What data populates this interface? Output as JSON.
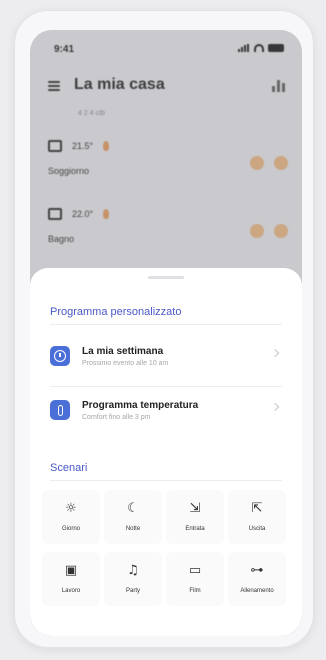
{
  "status": {
    "time": "9:41"
  },
  "header": {
    "title": "La mia casa",
    "subtitle": "4 2 4 ctb",
    "subtitle_display": " "
  },
  "rooms": [
    {
      "name": "Soggiorno",
      "temperature": "21.5°"
    },
    {
      "name": "Bagno",
      "temperature": "22.0°"
    }
  ],
  "sheet": {
    "program_section_title": "Programma personalizzato",
    "programs": [
      {
        "title": "La mia settimana",
        "subtitle": "Prossimo evento alle 10 am",
        "icon": "clock-icon"
      },
      {
        "title": "Programma temperatura",
        "subtitle": "Comfort fino alle 3 pm",
        "icon": "thermometer-icon"
      }
    ],
    "scenes_section_title": "Scenari",
    "scenes": [
      {
        "label": "Giorno",
        "icon": "sun-icon",
        "glyph": "☼"
      },
      {
        "label": "Notte",
        "icon": "moon-icon",
        "glyph": "☾"
      },
      {
        "label": "Entrata",
        "icon": "entrance-icon",
        "glyph": "⇲"
      },
      {
        "label": "Uscita",
        "icon": "exit-icon",
        "glyph": "⇱"
      },
      {
        "label": "Lavoro",
        "icon": "briefcase-icon",
        "glyph": "▣"
      },
      {
        "label": "Party",
        "icon": "party-icon",
        "glyph": "♫"
      },
      {
        "label": "Film",
        "icon": "tv-icon",
        "glyph": "▭"
      },
      {
        "label": "Allenamento",
        "icon": "dumbbell-icon",
        "glyph": "⊶"
      }
    ]
  },
  "colors": {
    "accent": "#4a58c8",
    "program_icon": "#4a6fd6",
    "heating": "#e8a063"
  }
}
